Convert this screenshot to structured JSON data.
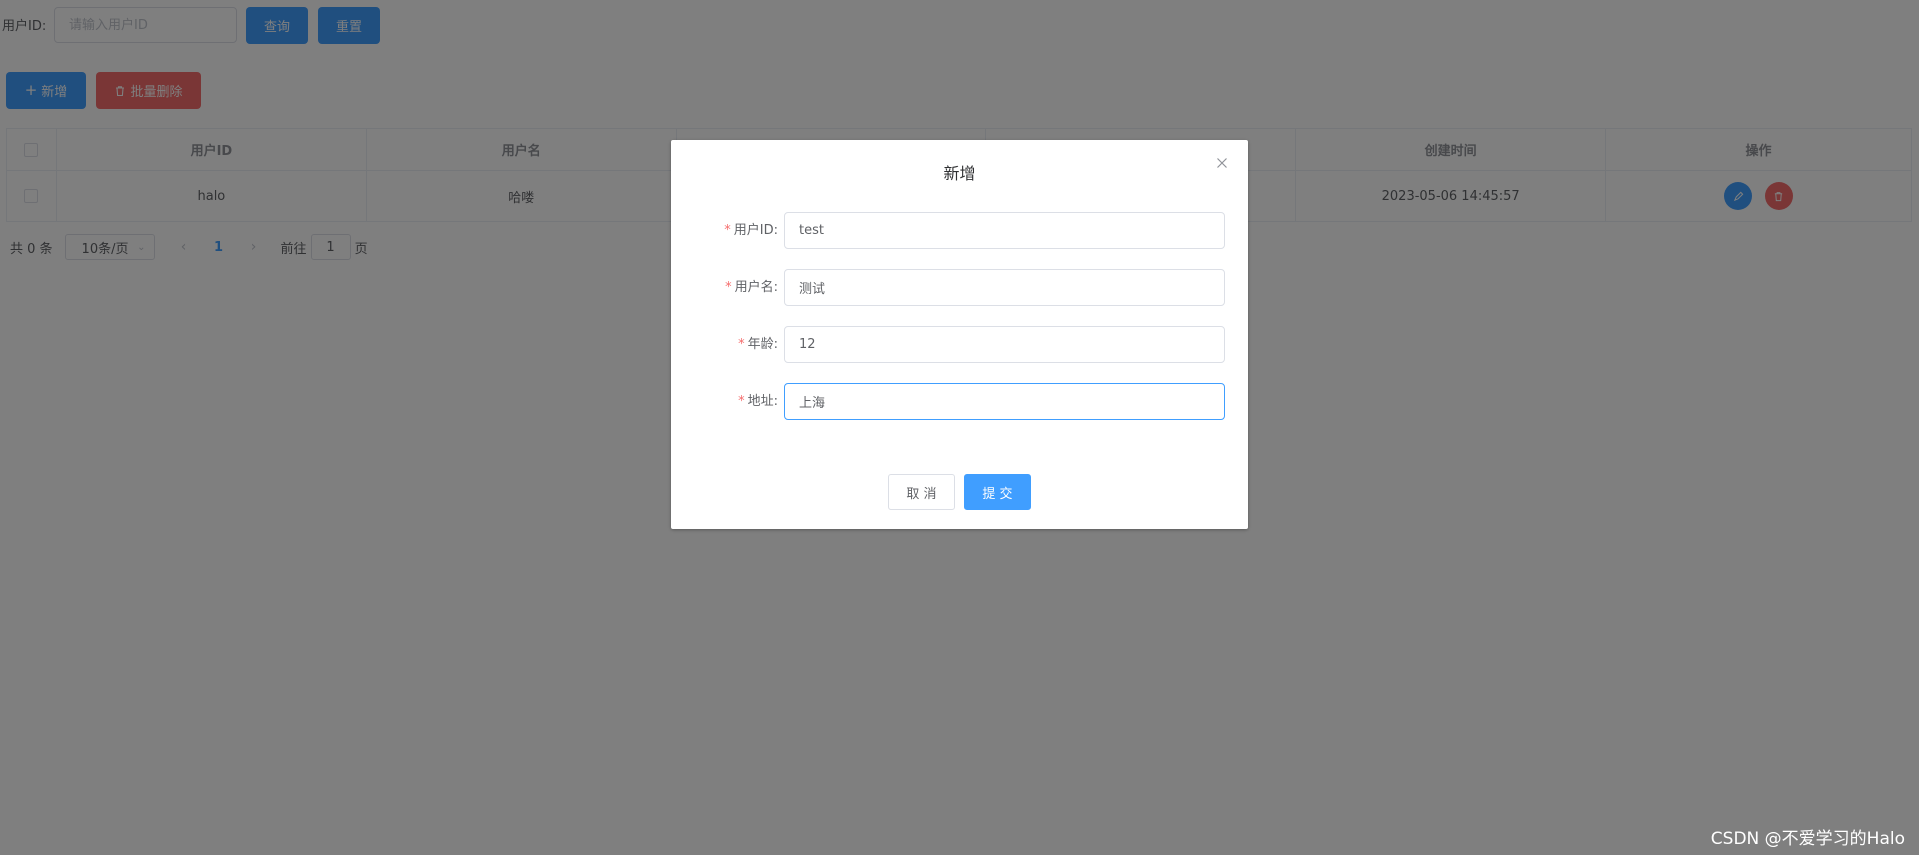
{
  "search": {
    "label": "用户ID:",
    "placeholder": "请输入用户ID",
    "query_button": "查询",
    "reset_button": "重置"
  },
  "toolbar": {
    "add_icon": "plus-icon",
    "add_button": "新增",
    "batch_delete_icon": "trash-icon",
    "batch_delete_button": "批量删除"
  },
  "table": {
    "columns": [
      "用户ID",
      "用户名",
      "",
      "",
      "创建时间",
      "操作"
    ],
    "rows": [
      {
        "user_id": "halo",
        "username": "哈喽",
        "created_at": "2023-05-06 14:45:57"
      }
    ],
    "edit_icon": "edit-icon",
    "delete_icon": "trash-icon"
  },
  "pagination": {
    "total": "共 0 条",
    "page_size": "10条/页",
    "current_page": "1",
    "goto_prefix": "前往",
    "goto_value": "1",
    "goto_suffix": "页"
  },
  "dialog": {
    "title": "新增",
    "close_icon": "close-icon",
    "fields": [
      {
        "label": "用户ID:",
        "value": "test",
        "required": true
      },
      {
        "label": "用户名:",
        "value": "测试",
        "required": true
      },
      {
        "label": "年龄:",
        "value": "12",
        "required": true
      },
      {
        "label": "地址:",
        "value": "上海",
        "required": true,
        "focused": true
      }
    ],
    "cancel_button": "取 消",
    "submit_button": "提 交"
  },
  "colors": {
    "primary": "#409eff",
    "danger": "#f56c6c",
    "required_mark": "#f56c6c",
    "overlay": "rgba(0,0,0,0.5)"
  },
  "watermark": "CSDN @不爱学习的Halo"
}
